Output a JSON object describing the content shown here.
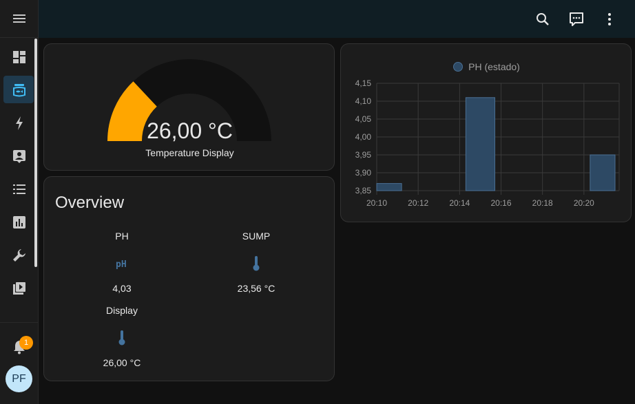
{
  "sidebar": {
    "items": [
      {
        "name": "overview",
        "icon": "dashboard-icon",
        "active": false
      },
      {
        "name": "aquarium",
        "icon": "fishbowl-icon",
        "active": true
      },
      {
        "name": "energy",
        "icon": "lightning-icon",
        "active": false
      },
      {
        "name": "logbook",
        "icon": "account-box-icon",
        "active": false
      },
      {
        "name": "todo",
        "icon": "list-icon",
        "active": false
      },
      {
        "name": "history",
        "icon": "chart-box-icon",
        "active": false
      },
      {
        "name": "developer-tools",
        "icon": "wrench-icon",
        "active": false
      },
      {
        "name": "media",
        "icon": "play-box-icon",
        "active": false
      }
    ],
    "notifications_count": "1",
    "user_initials": "PF"
  },
  "header": {
    "icons": [
      "search-icon",
      "assist-icon",
      "more-vert-icon"
    ]
  },
  "gauge": {
    "value": "26,00 °C",
    "name": "Temperature Display",
    "fill_fraction": 0.26,
    "color": "#ffa600"
  },
  "overview": {
    "title": "Overview",
    "entities": [
      {
        "name": "PH",
        "icon": "ph-icon",
        "value": "4,03"
      },
      {
        "name": "SUMP",
        "icon": "thermometer-icon",
        "value": "23,56 °C"
      },
      {
        "name": "Display",
        "icon": "thermometer-icon",
        "value": "26,00 °C"
      }
    ]
  },
  "chart_data": {
    "type": "bar",
    "legend": [
      "PH (estado)"
    ],
    "series": [
      {
        "name": "PH (estado)",
        "bars": [
          {
            "start": "20:10",
            "end": "20:11.2",
            "value": 3.87
          },
          {
            "start": "20:14.3",
            "end": "20:15.7",
            "value": 4.11
          },
          {
            "start": "20:20.3",
            "end": "20:21.5",
            "value": 3.95
          }
        ]
      }
    ],
    "x_ticks": [
      "20:10",
      "20:12",
      "20:14",
      "20:16",
      "20:18",
      "20:20"
    ],
    "y_ticks": [
      "3,85",
      "3,90",
      "3,95",
      "4,00",
      "4,05",
      "4,10",
      "4,15"
    ],
    "ylim": [
      3.85,
      4.15
    ],
    "grid": true,
    "bar_color": "#2d4964",
    "bar_edge_color": "#4a6f93"
  }
}
